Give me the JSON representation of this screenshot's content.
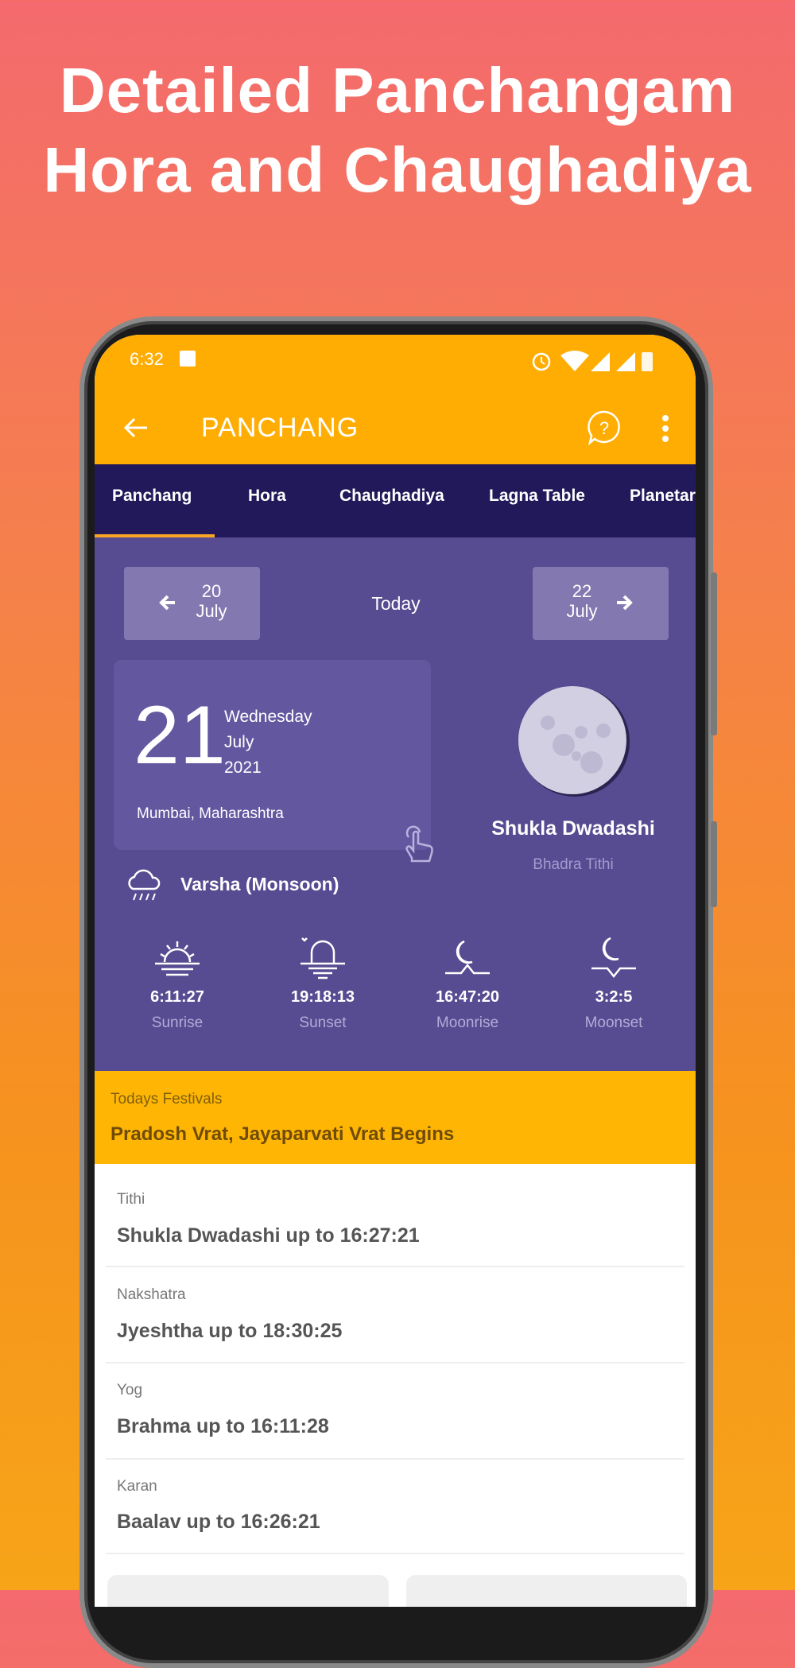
{
  "headline": {
    "line1": "Detailed Panchangam",
    "line2": "Hora and Chaughadiya"
  },
  "status_bar": {
    "time": "6:32",
    "icons": [
      "image-icon",
      "alarm-icon",
      "wifi-icon",
      "signal-icon",
      "signal-icon",
      "battery-icon"
    ]
  },
  "app_bar": {
    "title": "PANCHANG",
    "back_icon": "arrow-left-icon",
    "help_icon": "help-chat-icon",
    "menu_icon": "more-vert-icon"
  },
  "tabs": [
    {
      "label": "Panchang",
      "active": true
    },
    {
      "label": "Hora"
    },
    {
      "label": "Chaughadiya"
    },
    {
      "label": "Lagna Table"
    },
    {
      "label": "Planetar"
    }
  ],
  "date_nav": {
    "prev": {
      "day": "20",
      "month": "July"
    },
    "current": "Today",
    "next": {
      "day": "22",
      "month": "July"
    }
  },
  "date_card": {
    "day": "21",
    "weekday": "Wednesday",
    "month": "July",
    "year": "2021",
    "location": "Mumbai, Maharashtra"
  },
  "moon": {
    "phase": "Shukla Dwadashi",
    "tithi_type": "Bhadra Tithi"
  },
  "season": "Varsha (Monsoon)",
  "sun_moon": [
    {
      "time": "6:11:27",
      "label": "Sunrise",
      "icon": "sunrise-icon"
    },
    {
      "time": "19:18:13",
      "label": "Sunset",
      "icon": "sunset-icon"
    },
    {
      "time": "16:47:20",
      "label": "Moonrise",
      "icon": "moonrise-icon"
    },
    {
      "time": "3:2:5",
      "label": "Moonset",
      "icon": "moonset-icon"
    }
  ],
  "festivals": {
    "label": "Todays Festivals",
    "value": "Pradosh Vrat, Jayaparvati Vrat Begins"
  },
  "details": [
    {
      "label": "Tithi",
      "value": "Shukla Dwadashi up to 16:27:21"
    },
    {
      "label": "Nakshatra",
      "value": "Jyeshtha up to 18:30:25"
    },
    {
      "label": "Yog",
      "value": "Brahma up to 16:11:28"
    },
    {
      "label": "Karan",
      "value": "Baalav up to 16:26:21"
    }
  ],
  "colors": {
    "app_bar": "#ffad03",
    "tab_bar": "#22195a",
    "panel": "#574b91",
    "festival": "#ffb504",
    "indicator": "#f5a623"
  }
}
